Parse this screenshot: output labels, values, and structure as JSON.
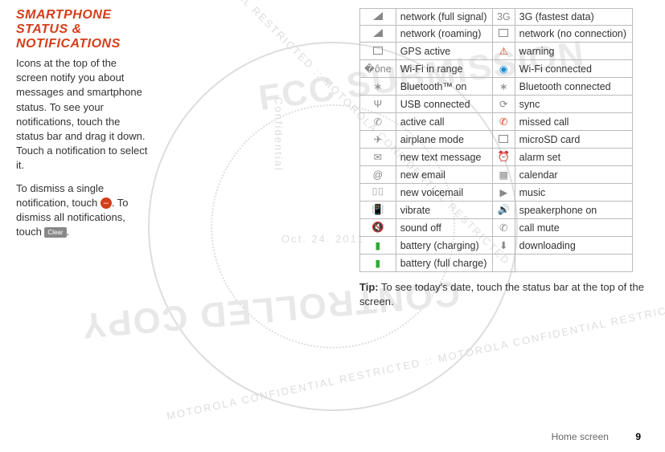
{
  "title": "SMARTPHONE STATUS & NOTIFICATIONS",
  "para1": "Icons at the top of the screen notify you about messages and smartphone status. To see your notifications, touch the status bar and drag it down. Touch a notification to select it.",
  "para2_a": "To dismiss a single notification, touch ",
  "para2_b": ". To dismiss all notifications, touch ",
  "para2_c": ".",
  "clear_label": "Clear",
  "tip_label": "Tip:",
  "tip_text": " To see today's date, touch the status bar at the top of the screen.",
  "footer_section": "Home screen",
  "footer_page": "9",
  "watermarks": {
    "fcc": "FCC SUBMISSION",
    "copy": "CONTROLLED COPY",
    "conf": "Confidential",
    "date": "Oct. 24. 2011",
    "ring": "MOTOROLA CONFIDENTIAL RESTRICTED :: MOTOROLA CONFIDENTIAL RESTRICTED ::"
  },
  "rows": [
    {
      "l_icon": "signal-icon",
      "l": "network (full signal)",
      "r_icon": "3g-icon",
      "r_icon_text": "3G",
      "r": "3G (fastest data)"
    },
    {
      "l_icon": "roaming-icon",
      "l": "network (roaming)",
      "r_icon": "no-network-icon",
      "r": "network (no connection)"
    },
    {
      "l_icon": "gps-icon",
      "l": "GPS active",
      "r_icon": "warning-icon",
      "r_icon_text": "⚠",
      "r_color": "#d43d1a",
      "r": "warning"
    },
    {
      "l_icon": "wifi-range-icon",
      "l_icon_text": "�ône",
      "l": "Wi-Fi in range",
      "r_icon": "wifi-connected-icon",
      "r_icon_text": "◉",
      "r_color": "#1a8cd4",
      "r": "Wi-Fi connected"
    },
    {
      "l_icon": "bluetooth-icon",
      "l_icon_text": "∗",
      "l": "Bluetooth™ on",
      "r_icon": "bluetooth-connected-icon",
      "r_icon_text": "∗",
      "r": "Bluetooth connected"
    },
    {
      "l_icon": "usb-icon",
      "l_icon_text": "Ψ",
      "l": "USB connected",
      "r_icon": "sync-icon",
      "r_icon_text": "⟳",
      "r": "sync"
    },
    {
      "l_icon": "active-call-icon",
      "l_icon_text": "✆",
      "l": "active call",
      "r_icon": "missed-call-icon",
      "r_icon_text": "✆",
      "r_color": "#d43d1a",
      "r": "missed call"
    },
    {
      "l_icon": "airplane-icon",
      "l_icon_text": "✈",
      "l": "airplane mode",
      "r_icon": "microsd-icon",
      "r": "microSD card"
    },
    {
      "l_icon": "message-icon",
      "l_icon_text": "✉",
      "l": "new text message",
      "r_icon": "alarm-icon",
      "r_icon_text": "⏰",
      "r": "alarm set"
    },
    {
      "l_icon": "email-icon",
      "l_icon_text": "@",
      "l": "new email",
      "r_icon": "calendar-icon",
      "r_icon_text": "▦",
      "r": "calendar"
    },
    {
      "l_icon": "voicemail-icon",
      "l_icon_text": "⌷⌷",
      "l": "new voicemail",
      "r_icon": "music-icon",
      "r_icon_text": "▶",
      "r": "music"
    },
    {
      "l_icon": "vibrate-icon",
      "l_icon_text": "📳",
      "l": "vibrate",
      "r_icon": "speaker-icon",
      "r_icon_text": "🔊",
      "r": "speakerphone on"
    },
    {
      "l_icon": "sound-off-icon",
      "l_icon_text": "🔇",
      "l": "sound off",
      "r_icon": "mute-icon",
      "r_icon_text": "✆",
      "r": "call mute"
    },
    {
      "l_icon": "battery-charging-icon",
      "l_icon_text": "▮",
      "l_color": "#3a3",
      "l": "battery (charging)",
      "r_icon": "download-icon",
      "r_icon_text": "⬇",
      "r": "downloading"
    },
    {
      "l_icon": "battery-full-icon",
      "l_icon_text": "▮",
      "l_color": "#3a3",
      "l": "battery (full charge)",
      "r_icon": "",
      "r": ""
    }
  ]
}
